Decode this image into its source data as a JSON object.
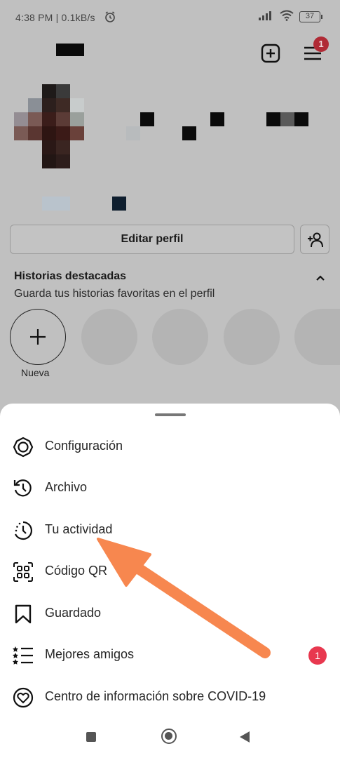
{
  "status_bar": {
    "time_speed": "4:38 PM | 0.1kB/s",
    "battery": "37"
  },
  "header": {
    "notification_count": "1"
  },
  "profile": {
    "edit_profile_label": "Editar perfil"
  },
  "highlights": {
    "title": "Historias destacadas",
    "subtitle": "Guarda tus historias favoritas en el perfil",
    "new_label": "Nueva"
  },
  "menu": {
    "items": [
      {
        "label": "Configuración",
        "icon": "settings-gear-icon"
      },
      {
        "label": "Archivo",
        "icon": "archive-history-icon"
      },
      {
        "label": "Tu actividad",
        "icon": "activity-clock-icon"
      },
      {
        "label": "Código QR",
        "icon": "qr-code-icon"
      },
      {
        "label": "Guardado",
        "icon": "bookmark-icon"
      },
      {
        "label": "Mejores amigos",
        "icon": "close-friends-list-icon",
        "badge": "1"
      },
      {
        "label": "Centro de información sobre COVID-19",
        "icon": "covid-heart-icon"
      }
    ]
  },
  "colors": {
    "badge_red": "#e8384f",
    "annotation_arrow": "#f7874f",
    "dim_overlay": "#c0c0c0"
  }
}
